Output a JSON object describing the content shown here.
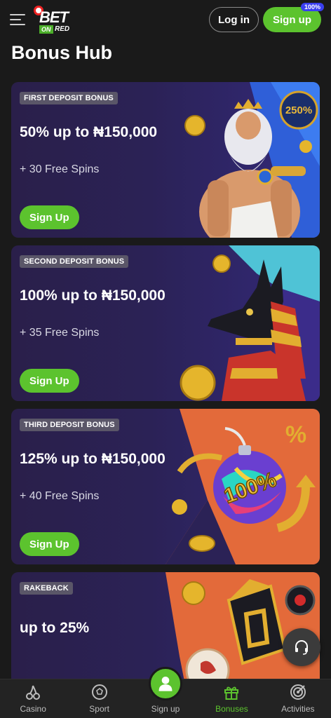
{
  "header": {
    "login_label": "Log in",
    "signup_label": "Sign up",
    "badge": "100%",
    "logo_top": "BET",
    "logo_on": "ON",
    "logo_red": "RED"
  },
  "page_title": "Bonus Hub",
  "cards": [
    {
      "tag": "FIRST DEPOSIT BONUS",
      "headline": "50% up to ₦150,000",
      "spins": "+ 30 Free Spins",
      "cta": "Sign Up"
    },
    {
      "tag": "SECOND DEPOSIT BONUS",
      "headline": "100% up to ₦150,000",
      "spins": "+ 35 Free Spins",
      "cta": "Sign Up"
    },
    {
      "tag": "THIRD DEPOSIT BONUS",
      "headline": "125% up to ₦150,000",
      "spins": "+ 40 Free Spins",
      "cta": "Sign Up"
    },
    {
      "tag": "RAKEBACK",
      "headline": "up to 25%",
      "spins": "",
      "cta": ""
    }
  ],
  "card_art_text": {
    "zeus_badge": "250%",
    "bomb_text": "100%",
    "percent_icon": "%"
  },
  "bottom_nav": [
    {
      "label": "Casino",
      "icon": "cherries-icon"
    },
    {
      "label": "Sport",
      "icon": "soccer-ball-icon"
    },
    {
      "label": "Sign up",
      "icon": "user-icon"
    },
    {
      "label": "Bonuses",
      "icon": "gift-icon"
    },
    {
      "label": "Activities",
      "icon": "target-icon"
    }
  ],
  "colors": {
    "accent": "#5cc32e",
    "background": "#1a1a1a",
    "card": "#2b2256"
  }
}
